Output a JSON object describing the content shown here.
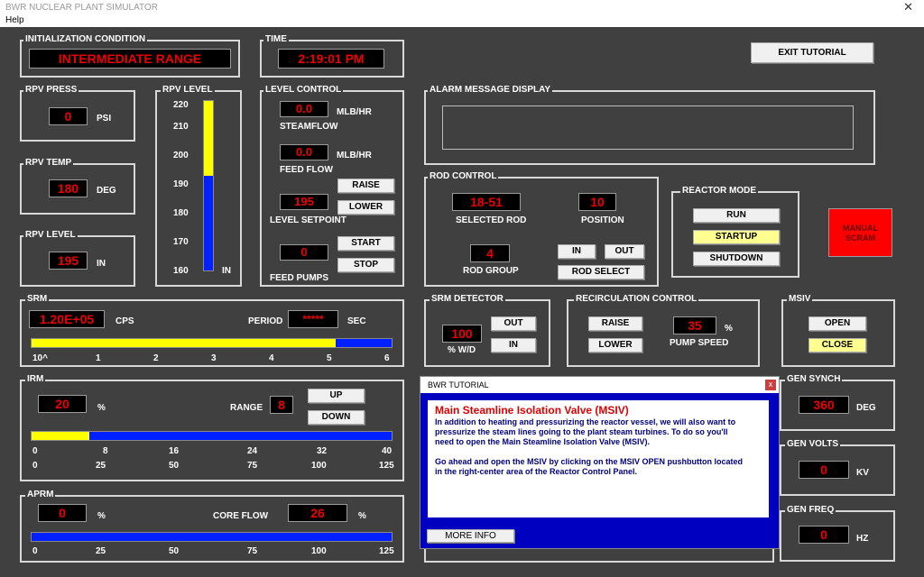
{
  "window": {
    "title": "BWR NUCLEAR PLANT SIMULATOR",
    "close": "✕",
    "menu_help": "Help"
  },
  "init": {
    "label": "INITIALIZATION CONDITION",
    "value": "INTERMEDIATE RANGE"
  },
  "time": {
    "label": "TIME",
    "value": "2:19:01 PM"
  },
  "exit_tutorial": "EXIT TUTORIAL",
  "rpv_press": {
    "label": "RPV PRESS",
    "value": "0",
    "unit": "PSI"
  },
  "rpv_temp": {
    "label": "RPV TEMP",
    "value": "180",
    "unit": "DEG"
  },
  "rpv_level_small": {
    "label": "RPV LEVEL",
    "value": "195",
    "unit": "IN"
  },
  "rpv_level": {
    "label": "RPV LEVEL",
    "ticks": [
      "220",
      "210",
      "200",
      "190",
      "180",
      "170",
      "160"
    ],
    "unit": "IN",
    "level_fraction": 0.56
  },
  "level_control": {
    "label": "LEVEL CONTROL",
    "steamflow": "0.0",
    "steamflow_unit": "MLB/HR",
    "steamflow_label": "STEAMFLOW",
    "feedflow": "0.0",
    "feedflow_unit": "MLB/HR",
    "feedflow_label": "FEED FLOW",
    "setpoint": "195",
    "setpoint_label": "LEVEL SETPOINT",
    "raise": "RAISE",
    "lower": "LOWER",
    "pumps": "0",
    "pumps_label": "FEED PUMPS",
    "start": "START",
    "stop": "STOP"
  },
  "alarm": {
    "label": "ALARM MESSAGE DISPLAY"
  },
  "rod_control": {
    "label": "ROD CONTROL",
    "selected_rod": "18-51",
    "selected_rod_label": "SELECTED ROD",
    "position": "10",
    "position_label": "POSITION",
    "group": "4",
    "group_label": "ROD GROUP",
    "in": "IN",
    "out": "OUT",
    "rod_select": "ROD SELECT"
  },
  "reactor_mode": {
    "label": "REACTOR MODE",
    "run": "RUN",
    "startup": "STARTUP",
    "shutdown": "SHUTDOWN"
  },
  "scram": {
    "line1": "MANUAL",
    "line2": "SCRAM",
    "color": "#ff0000"
  },
  "srm": {
    "label": "SRM",
    "value": "1.20E+05",
    "unit": "CPS",
    "period_label": "PERIOD",
    "period": "*****",
    "period_unit": "SEC",
    "ticks": [
      "10^",
      "1",
      "2",
      "3",
      "4",
      "5",
      "6"
    ],
    "fill_fraction": 0.845
  },
  "srm_detector": {
    "label": "SRM DETECTOR",
    "value": "100",
    "unit": "% W/D",
    "out": "OUT",
    "in": "IN"
  },
  "recirc": {
    "label": "RECIRCULATION CONTROL",
    "raise": "RAISE",
    "lower": "LOWER",
    "speed": "35",
    "speed_unit": "%",
    "speed_label": "PUMP SPEED"
  },
  "msiv": {
    "label": "MSIV",
    "open": "OPEN",
    "close": "CLOSE"
  },
  "irm": {
    "label": "IRM",
    "value": "20",
    "unit": "%",
    "range_label": "RANGE",
    "range": "8",
    "up": "UP",
    "down": "DOWN",
    "ticks1": [
      "0",
      "8",
      "16",
      "24",
      "32",
      "40"
    ],
    "ticks2": [
      "0",
      "25",
      "50",
      "75",
      "100",
      "125"
    ],
    "fill_fraction": 0.16
  },
  "aprm": {
    "label": "APRM",
    "value": "0",
    "unit": "%",
    "core_flow_label": "CORE FLOW",
    "core_flow": "26",
    "core_flow_unit": "%",
    "ticks": [
      "0",
      "25",
      "50",
      "75",
      "100",
      "125"
    ]
  },
  "gen_synch": {
    "label": "GEN SYNCH",
    "value": "360",
    "unit": "DEG"
  },
  "gen_volts": {
    "label": "GEN VOLTS",
    "value": "0",
    "unit": "KV"
  },
  "gen_freq": {
    "label": "GEN FREQ",
    "value": "0",
    "unit": "HZ"
  },
  "tutorial": {
    "title": "BWR TUTORIAL",
    "close": "x",
    "heading": "Main Steamline Isolation Valve (MSIV)",
    "lines": [
      "In addition to heating and pressurizing the reactor vessel, we will also want to",
      "pressurize the steam lines going to the plant steam turbines.  To do so you'll",
      "need to open the Main Steamline Isolation Valve (MSIV)."
    ],
    "lines2": [
      "Go ahead and open the MSIV by clicking on the MSIV OPEN pushbutton located",
      "in the right-center area of the Reactor Control Panel."
    ],
    "more_info": "MORE INFO"
  }
}
